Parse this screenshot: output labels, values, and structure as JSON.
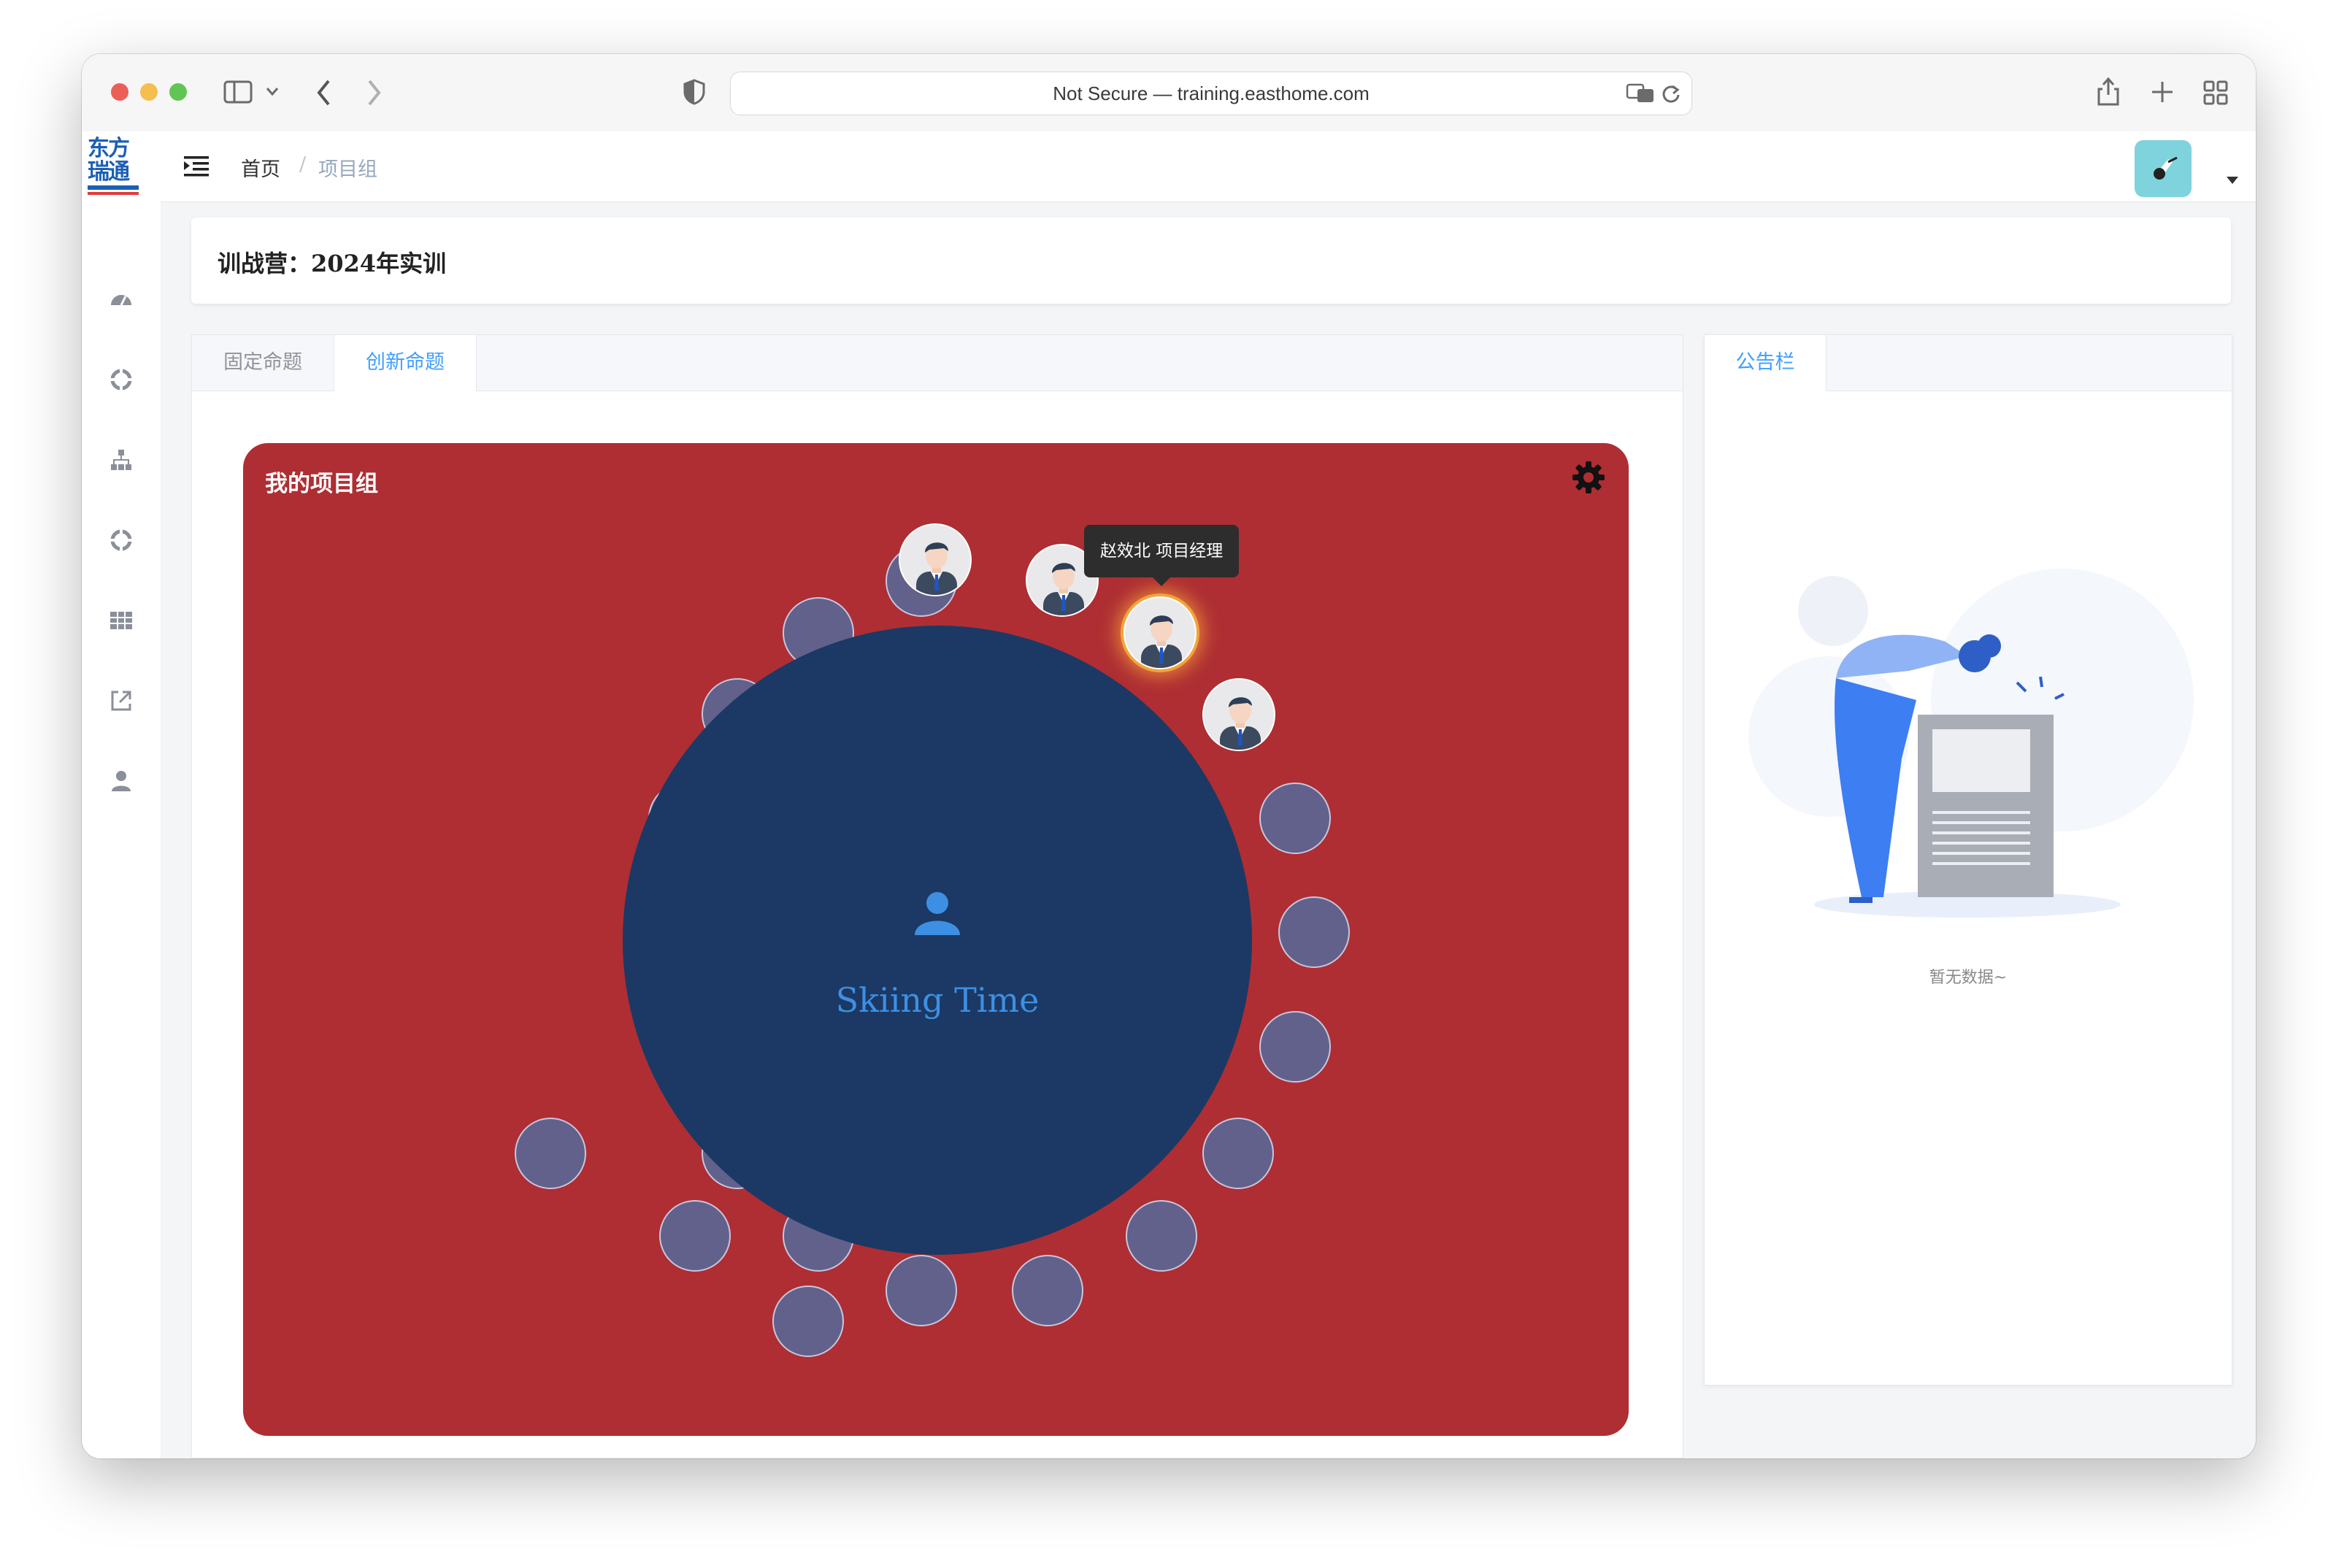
{
  "browser": {
    "url_text": "Not Secure — training.easthome.com",
    "traffic_lights": [
      "#ec5f57",
      "#f4bf4f",
      "#61c554"
    ]
  },
  "app": {
    "logo_text": [
      "东方",
      "瑞通"
    ],
    "breadcrumb": {
      "home": "首页",
      "separator": "/",
      "current": "项目组"
    },
    "sidebar_icons": [
      "dashboard-icon",
      "target-icon",
      "org-chart-icon",
      "target-icon",
      "grid-icon",
      "external-link-icon",
      "user-icon"
    ]
  },
  "camp": {
    "title": "训战营：2024年实训"
  },
  "tabs": [
    {
      "label": "固定命题",
      "active": false
    },
    {
      "label": "创新命题",
      "active": true
    }
  ],
  "project_group": {
    "title": "我的项目组",
    "project_name": "Skiing Time",
    "seats_total": 22,
    "occupied_seats": 4,
    "tooltip": "赵效北 项目经理",
    "colors": {
      "background": "#ae2e33",
      "table": "#1b3964",
      "seat": "#62618c",
      "accent": "#3d8fe3"
    }
  },
  "bulletin": {
    "tab_label": "公告栏",
    "empty_text": "暂无数据~"
  }
}
